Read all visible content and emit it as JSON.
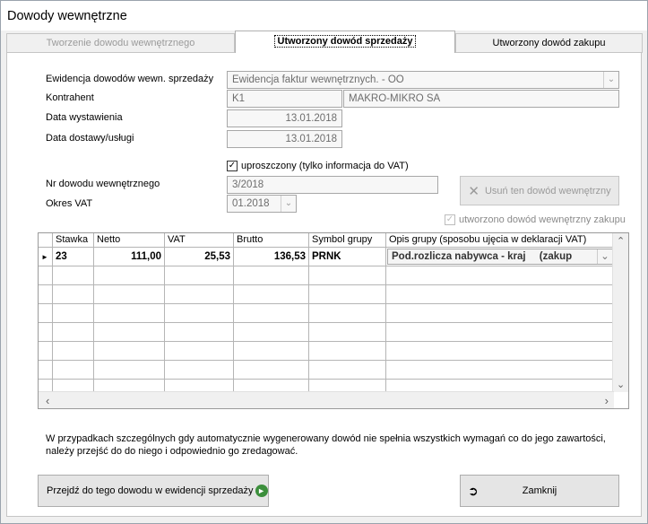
{
  "window": {
    "title": "Dowody wewnętrzne"
  },
  "tabs": [
    {
      "label": "Tworzenie  dowodu wewnętrznego"
    },
    {
      "label": "Utworzony dowód sprzedaży"
    },
    {
      "label": "Utworzony dowód zakupu"
    }
  ],
  "form": {
    "ewidencja_label": "Ewidencja dowodów wewn. sprzedaży",
    "ewidencja_value": "Ewidencja faktur wewnętrznych. - OO",
    "kontrahent_label": "Kontrahent",
    "kontrahent_code": "K1",
    "kontrahent_name": "MAKRO-MIKRO SA",
    "data_wyst_label": "Data wystawienia",
    "data_wyst_value": "13.01.2018",
    "data_dost_label": "Data dostawy/usługi",
    "data_dost_value": "13.01.2018",
    "uproszczony_label": "uproszczony (tylko informacja do VAT)",
    "nr_label": "Nr dowodu wewnętrznego",
    "nr_value": "3/2018",
    "okres_label": "Okres VAT",
    "okres_value": "01.2018",
    "usun_label": "Usuń ten dowód wewnętrzny",
    "zakup_chk_label": "utworzono dowód  wewnętrzny zakupu"
  },
  "grid": {
    "columns": [
      "Stawka",
      "Netto",
      "VAT",
      "Brutto",
      "Symbol grupy",
      "Opis grupy (sposobu ujęcia w  deklaracji VAT)"
    ],
    "rows": [
      {
        "stawka": "23",
        "netto": "111,00",
        "vat": "25,53",
        "brutto": "136,53",
        "symbol": "PRNK",
        "opis": "Pod.rozlicza nabywca - kraj",
        "opis_extra": "(zakup"
      }
    ]
  },
  "info": {
    "line1": "W przypadkach szczególnych  gdy automatycznie wygenerowany dowód nie spełnia wszystkich wymagań co do jego zawartości,",
    "line2": "należy przejść do do niego i odpowiednio go zredagować."
  },
  "buttons": {
    "przejdz": "Przejdź do tego dowodu w ewidencji sprzedaży",
    "zamknij": "Zamknij"
  },
  "colors": {
    "accent": "#2e7d32",
    "border": "#a7a7a7"
  }
}
